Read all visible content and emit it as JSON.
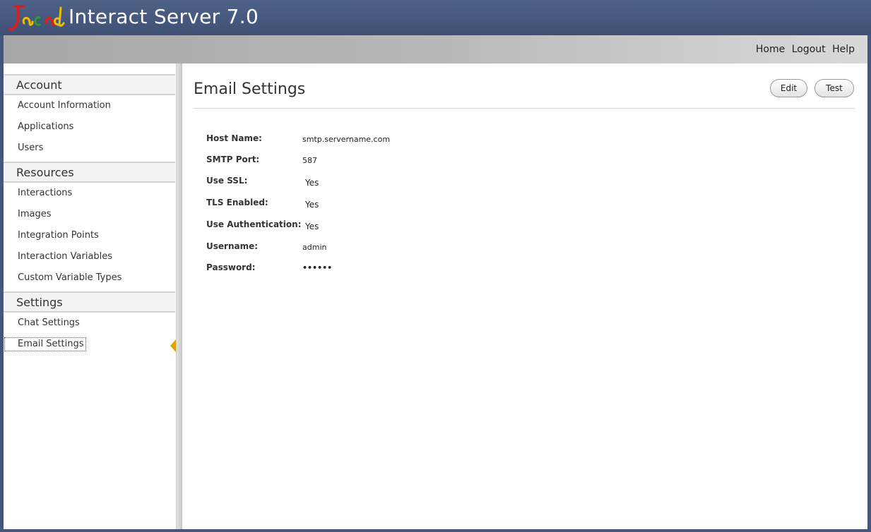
{
  "app": {
    "title": "Interact Server 7.0",
    "logo_text": "Jacada"
  },
  "top_links": [
    "Home",
    "Logout",
    "Help"
  ],
  "sidebar": {
    "sections": [
      {
        "header": "Account",
        "items": [
          "Account Information",
          "Applications",
          "Users"
        ]
      },
      {
        "header": "Resources",
        "items": [
          "Interactions",
          "Images",
          "Integration Points",
          "Interaction Variables",
          "Custom Variable Types"
        ]
      },
      {
        "header": "Settings",
        "items": [
          "Chat Settings",
          "Email Settings"
        ]
      }
    ],
    "active_item": "Email Settings"
  },
  "main": {
    "title": "Email Settings",
    "buttons": {
      "edit": "Edit",
      "test": "Test"
    },
    "fields": [
      {
        "label": "Host Name:",
        "value": "smtp.servername.com"
      },
      {
        "label": "SMTP Port:",
        "value": "587"
      },
      {
        "label": "Use SSL:",
        "value": "Yes"
      },
      {
        "label": "TLS Enabled:",
        "value": "Yes"
      },
      {
        "label": "Use Authentication:",
        "value": "Yes"
      },
      {
        "label": "Username:",
        "value": "admin"
      },
      {
        "label": "Password:",
        "value": "••••••"
      }
    ]
  },
  "colors": {
    "titlebar": "#45567a",
    "active_marker": "#e0a400"
  }
}
